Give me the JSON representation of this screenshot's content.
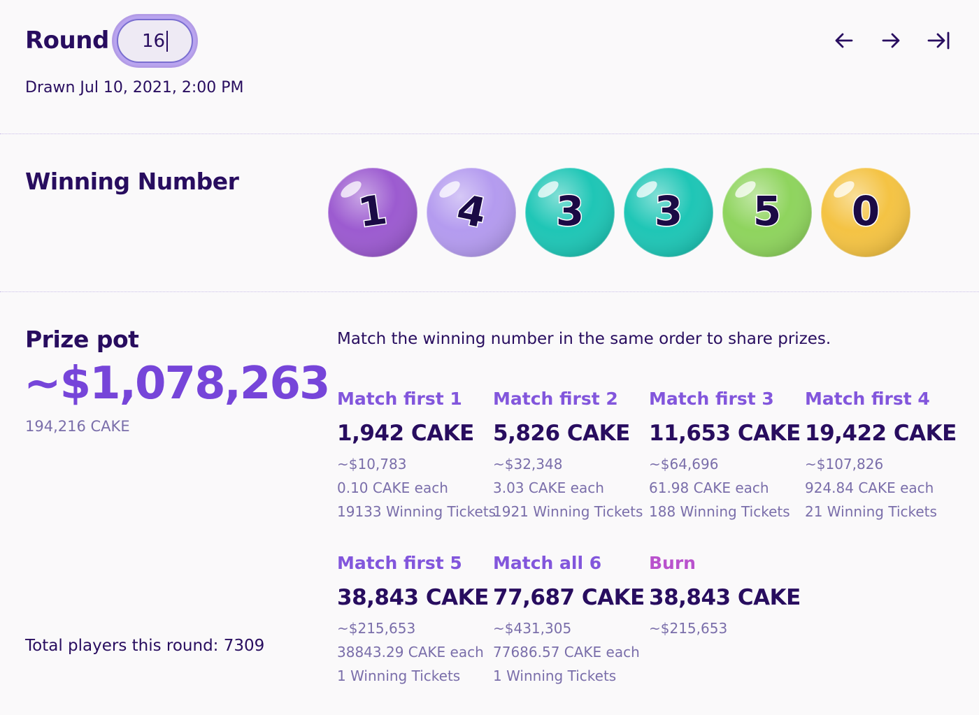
{
  "header": {
    "round_label": "Round",
    "round_value": "16",
    "drawn": "Drawn Jul 10, 2021, 2:00 PM",
    "nav": [
      "arrow-left-icon",
      "arrow-right-icon",
      "arrow-to-end-icon"
    ]
  },
  "winning": {
    "title": "Winning Number",
    "balls": [
      {
        "digit": "1",
        "color": "#9c5bd0"
      },
      {
        "digit": "4",
        "color": "#b49bef"
      },
      {
        "digit": "3",
        "color": "#1fc6b6"
      },
      {
        "digit": "3",
        "color": "#1fc6b6"
      },
      {
        "digit": "5",
        "color": "#8fd45e"
      },
      {
        "digit": "0",
        "color": "#f4c344"
      }
    ]
  },
  "prize": {
    "title": "Prize pot",
    "usd": "~$1,078,263",
    "cake": "194,216 CAKE",
    "total_players": "Total players this round: 7309",
    "description": "Match the winning number in the same order to share prizes."
  },
  "brackets": [
    {
      "title": "Match first 1",
      "cake": "1,942 CAKE",
      "usd": "~$10,783",
      "each": "0.10 CAKE each",
      "tickets": "19133 Winning Tickets"
    },
    {
      "title": "Match first 2",
      "cake": "5,826 CAKE",
      "usd": "~$32,348",
      "each": "3.03 CAKE each",
      "tickets": "1921 Winning Tickets"
    },
    {
      "title": "Match first 3",
      "cake": "11,653 CAKE",
      "usd": "~$64,696",
      "each": "61.98 CAKE each",
      "tickets": "188 Winning Tickets"
    },
    {
      "title": "Match first 4",
      "cake": "19,422 CAKE",
      "usd": "~$107,826",
      "each": "924.84 CAKE each",
      "tickets": "21 Winning Tickets"
    },
    {
      "title": "Match first 5",
      "cake": "38,843 CAKE",
      "usd": "~$215,653",
      "each": "38843.29 CAKE each",
      "tickets": "1 Winning Tickets"
    },
    {
      "title": "Match all 6",
      "cake": "77,687 CAKE",
      "usd": "~$431,305",
      "each": "77686.57 CAKE each",
      "tickets": "1 Winning Tickets"
    },
    {
      "title": "Burn",
      "cake": "38,843 CAKE",
      "usd": "~$215,653"
    }
  ],
  "colors": {
    "text_dark": "#280d5f",
    "accent_purple": "#7645d9",
    "text_sub": "#7a6eaa",
    "burn_title": "#b240c9"
  }
}
